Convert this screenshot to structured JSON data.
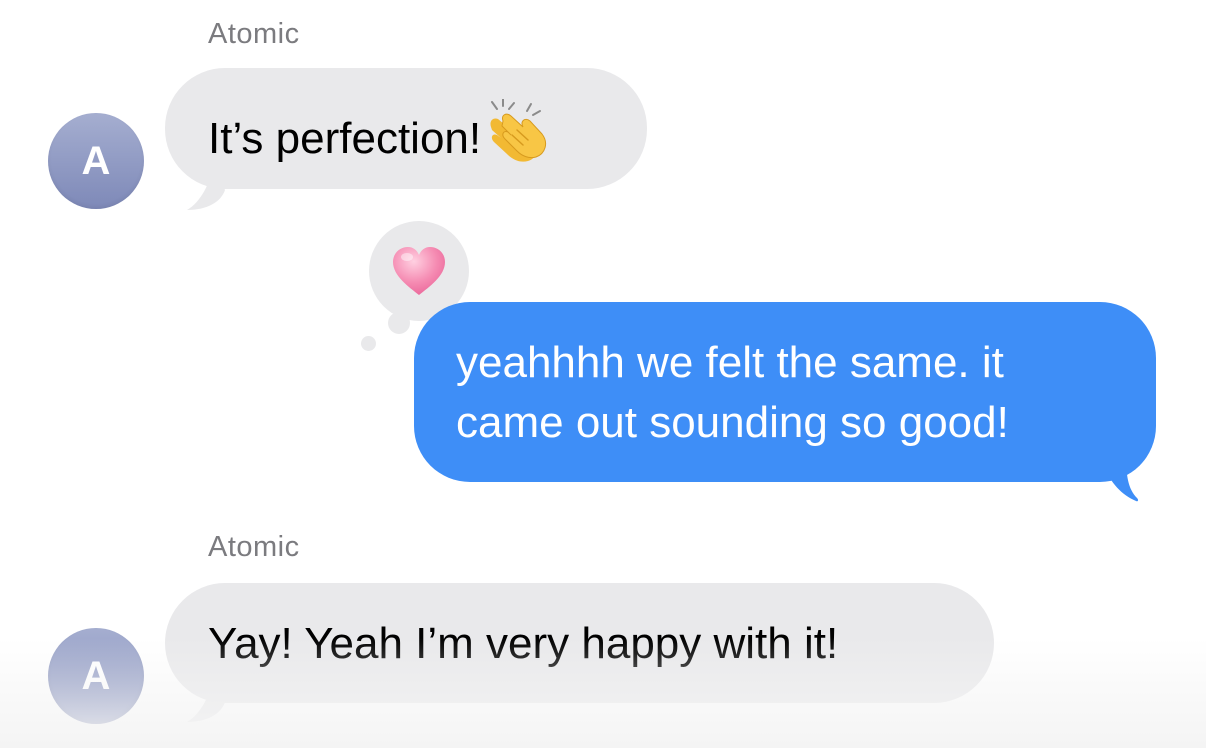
{
  "conversation": {
    "messages": [
      {
        "sender": "Atomic",
        "avatar_initial": "A",
        "text": "It’s perfection!",
        "emoji": "clapping-hands"
      },
      {
        "sender": "me",
        "text_lines": [
          "yeahhhh we felt the same. it",
          "came out sounding so good!"
        ],
        "reaction": "heart"
      },
      {
        "sender": "Atomic",
        "avatar_initial": "A",
        "text": "Yay! Yeah I’m very happy with it!"
      }
    ]
  },
  "colors": {
    "received_bubble": "#e9e9eb",
    "sent_bubble": "#3e8ef7",
    "sender_name": "#7b7b7f",
    "avatar": "#8f99c4",
    "reaction_heart": "#f58bb2"
  }
}
